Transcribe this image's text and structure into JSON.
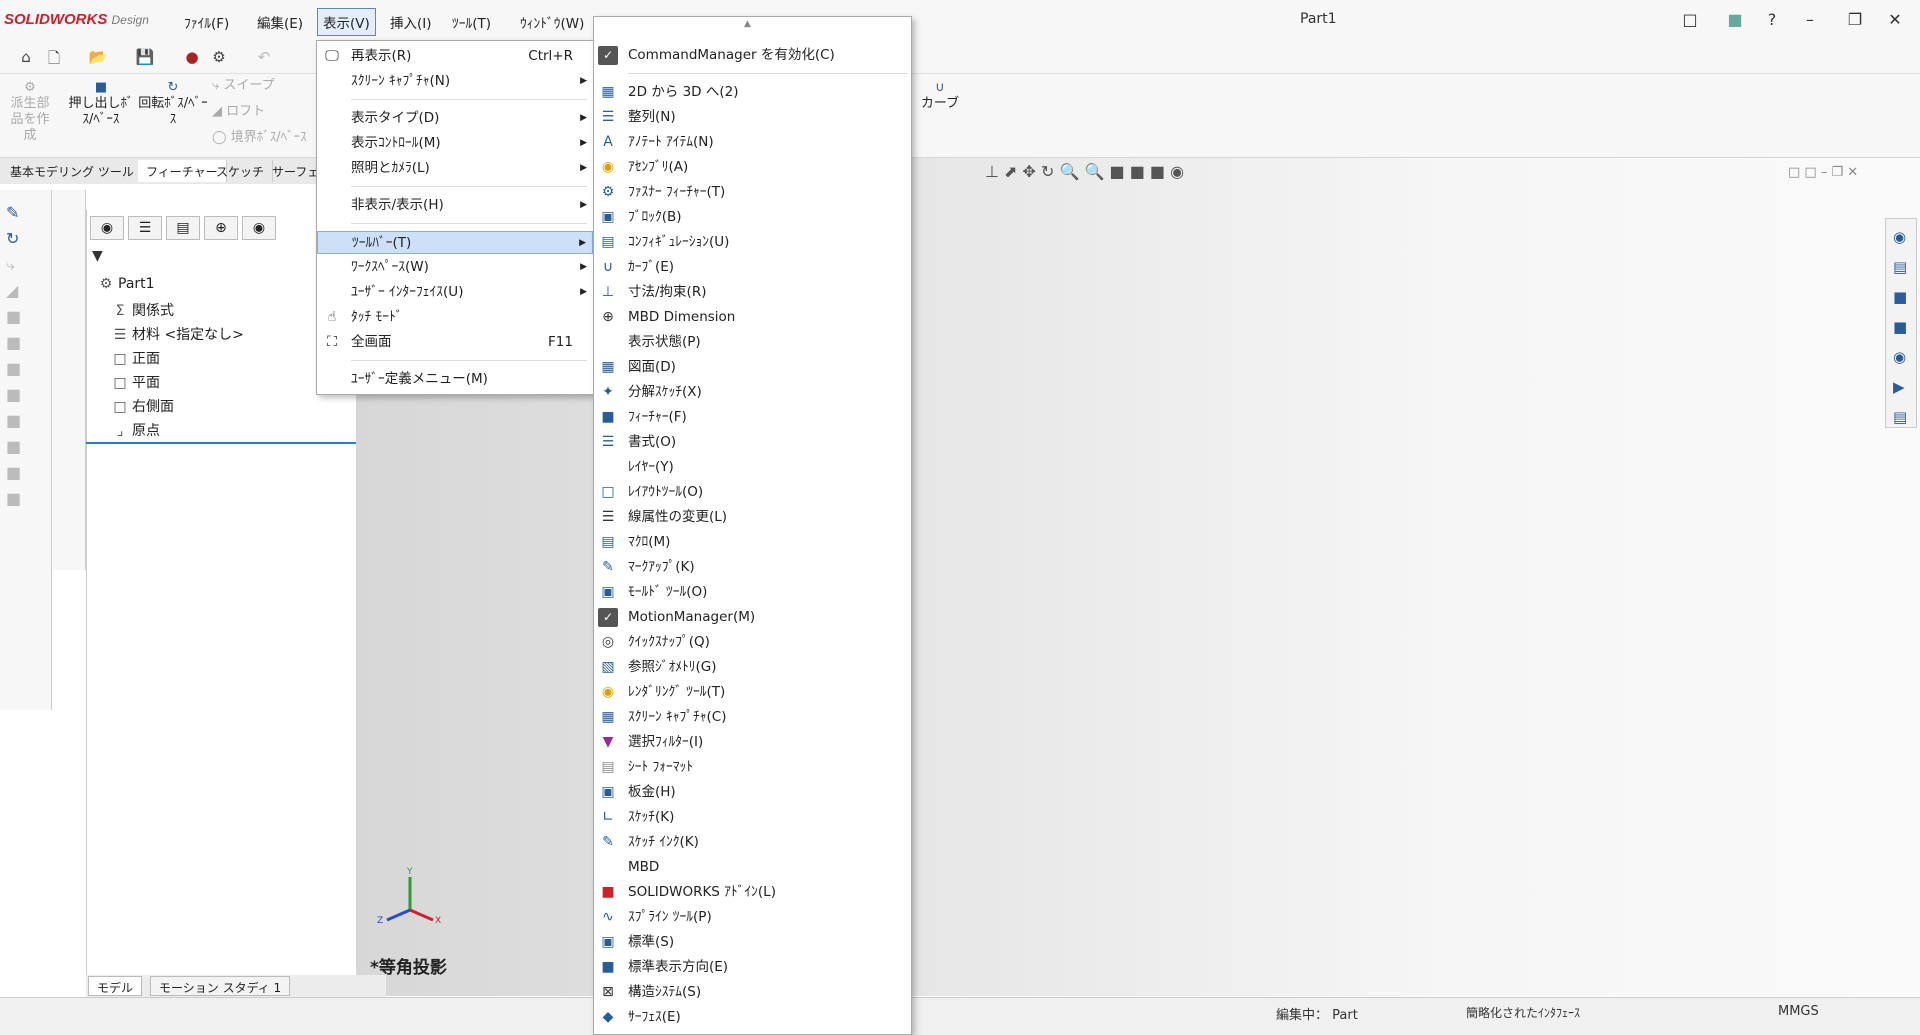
{
  "app": {
    "logo_brand": "SOLIDWORKS",
    "logo_suffix": "Design",
    "doc_title": "Part1"
  },
  "menubar": [
    {
      "label": "ﾌｧｲﾙ(F)"
    },
    {
      "label": "編集(E)"
    },
    {
      "label": "表示(V)"
    },
    {
      "label": "挿入(I)"
    },
    {
      "label": "ﾂｰﾙ(T)"
    },
    {
      "label": "ｳｨﾝﾄﾞｳ(W)"
    }
  ],
  "commandmanager": {
    "derived": "派生部品を作成",
    "extrude": "押し出しﾎﾞｽ/ﾍﾞｰｽ",
    "revolve": "回転ﾎﾞｽ/ﾍﾞｰｽ",
    "sweep": "スイープ",
    "loft": "ロフト",
    "boundary": "境界ﾎﾞｽ/ﾍﾞｰｽ",
    "curve": "カーブ"
  },
  "tabs": [
    "基本モデリング ツール",
    "フィーチャー",
    "スケッチ",
    "サーフェス"
  ],
  "tree": {
    "root": "Part1",
    "items": [
      "関係式",
      "材料 <指定なし>",
      "正面",
      "平面",
      "右側面",
      "原点"
    ]
  },
  "view_label": "*等角投影",
  "triad": {
    "x": "X",
    "y": "Y",
    "z": "Z"
  },
  "bottom_tabs": [
    "モデル",
    "モーション スタディ 1"
  ],
  "status": {
    "editing": "編集中： Part",
    "interface": "簡略化されたｲﾝﾀﾌｪｰｽ",
    "units": "MMGS"
  },
  "view_menu": [
    {
      "label": "再表示(R)",
      "shortcut": "Ctrl+R"
    },
    {
      "label": "ｽｸﾘｰﾝ ｷｬﾌﾟﾁｬ(N)"
    },
    {
      "label": "表示タイプ(D)"
    },
    {
      "label": "表示ｺﾝﾄﾛｰﾙ(M)"
    },
    {
      "label": "照明とｶﾒﾗ(L)"
    },
    {
      "label": "非表示/表示(H)"
    },
    {
      "label": "ﾂｰﾙﾊﾞｰ(T)"
    },
    {
      "label": "ﾜｰｸｽﾍﾟｰｽ(W)"
    },
    {
      "label": "ﾕｰｻﾞｰ ｲﾝﾀｰﾌｪｲｽ(U)"
    },
    {
      "label": "ﾀｯﾁ ﾓｰﾄﾞ"
    },
    {
      "label": "全画面",
      "shortcut": "F11"
    },
    {
      "label": "ﾕｰｻﾞｰ定義メニュー(M)"
    }
  ],
  "toolbar_menu": [
    "CommandManager を有効化(C)",
    "2D から 3D へ(2)",
    "整列(N)",
    "ｱﾉﾃｰﾄ ｱｲﾃﾑ(N)",
    "ｱｾﾝﾌﾞﾘ(A)",
    "ﾌｧｽﾅｰ ﾌｨｰﾁｬｰ(T)",
    "ﾌﾞﾛｯｸ(B)",
    "ｺﾝﾌｨｷﾞｭﾚｰｼｮﾝ(U)",
    "ｶｰﾌﾞ(E)",
    "寸法/拘束(R)",
    "MBD Dimension",
    "表示状態(P)",
    "図面(D)",
    "分解ｽｹｯﾁ(X)",
    "ﾌｨｰﾁｬｰ(F)",
    "書式(O)",
    "ﾚｲﾔｰ(Y)",
    "ﾚｲｱｳﾄﾂｰﾙ(O)",
    "線属性の変更(L)",
    "ﾏｸﾛ(M)",
    "ﾏｰｸｱｯﾌﾟ(K)",
    "ﾓｰﾙﾄﾞ ﾂｰﾙ(O)",
    "MotionManager(M)",
    "ｸｲｯｸｽﾅｯﾌﾟ(Q)",
    "参照ｼﾞｵﾒﾄﾘ(G)",
    "ﾚﾝﾀﾞﾘﾝｸﾞ ﾂｰﾙ(T)",
    "ｽｸﾘｰﾝ ｷｬﾌﾟﾁｬ(C)",
    "選択ﾌｨﾙﾀｰ(I)",
    "ｼｰﾄ ﾌｫｰﾏｯﾄ",
    "板金(H)",
    "ｽｹｯﾁ(K)",
    "ｽｹｯﾁ ｲﾝｸ(K)",
    "MBD",
    "SOLIDWORKS ｱﾄﾞｲﾝ(L)",
    "ｽﾌﾟﾗｲﾝ ﾂｰﾙ(P)",
    "標準(S)",
    "標準表示方向(E)",
    "構造ｼｽﾃﾑ(S)",
    "ｻｰﾌｪｽ(E)"
  ],
  "colors": {
    "accent": "#d0202a",
    "highlight": "#cde0f7"
  }
}
